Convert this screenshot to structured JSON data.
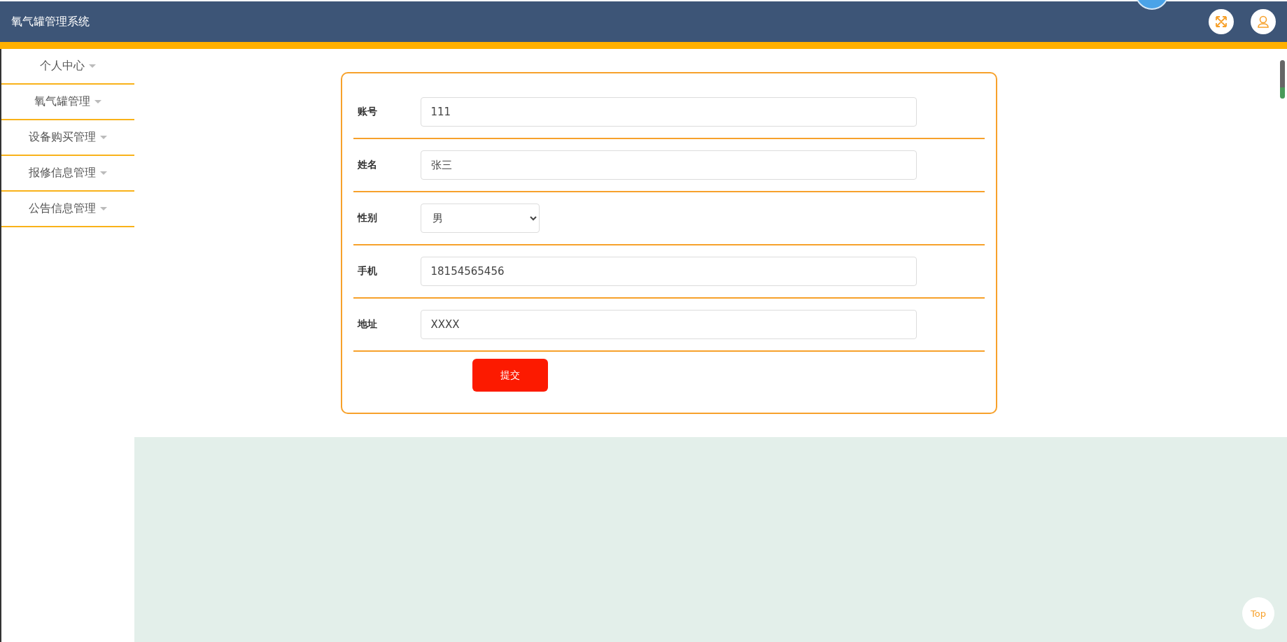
{
  "header": {
    "title": "氧气罐管理系统"
  },
  "sidebar": {
    "items": [
      {
        "label": "个人中心"
      },
      {
        "label": "氧气罐管理"
      },
      {
        "label": "设备购买管理"
      },
      {
        "label": "报修信息管理"
      },
      {
        "label": "公告信息管理"
      }
    ]
  },
  "form": {
    "fields": [
      {
        "label": "账号",
        "kind": "input",
        "value": "111"
      },
      {
        "label": "姓名",
        "kind": "input",
        "value": "张三"
      },
      {
        "label": "性别",
        "kind": "select",
        "value": "男"
      },
      {
        "label": "手机",
        "kind": "input",
        "value": "18154565456"
      },
      {
        "label": "地址",
        "kind": "input",
        "value": "XXXX"
      }
    ],
    "submit": "提交"
  },
  "back_to_top": "Top"
}
